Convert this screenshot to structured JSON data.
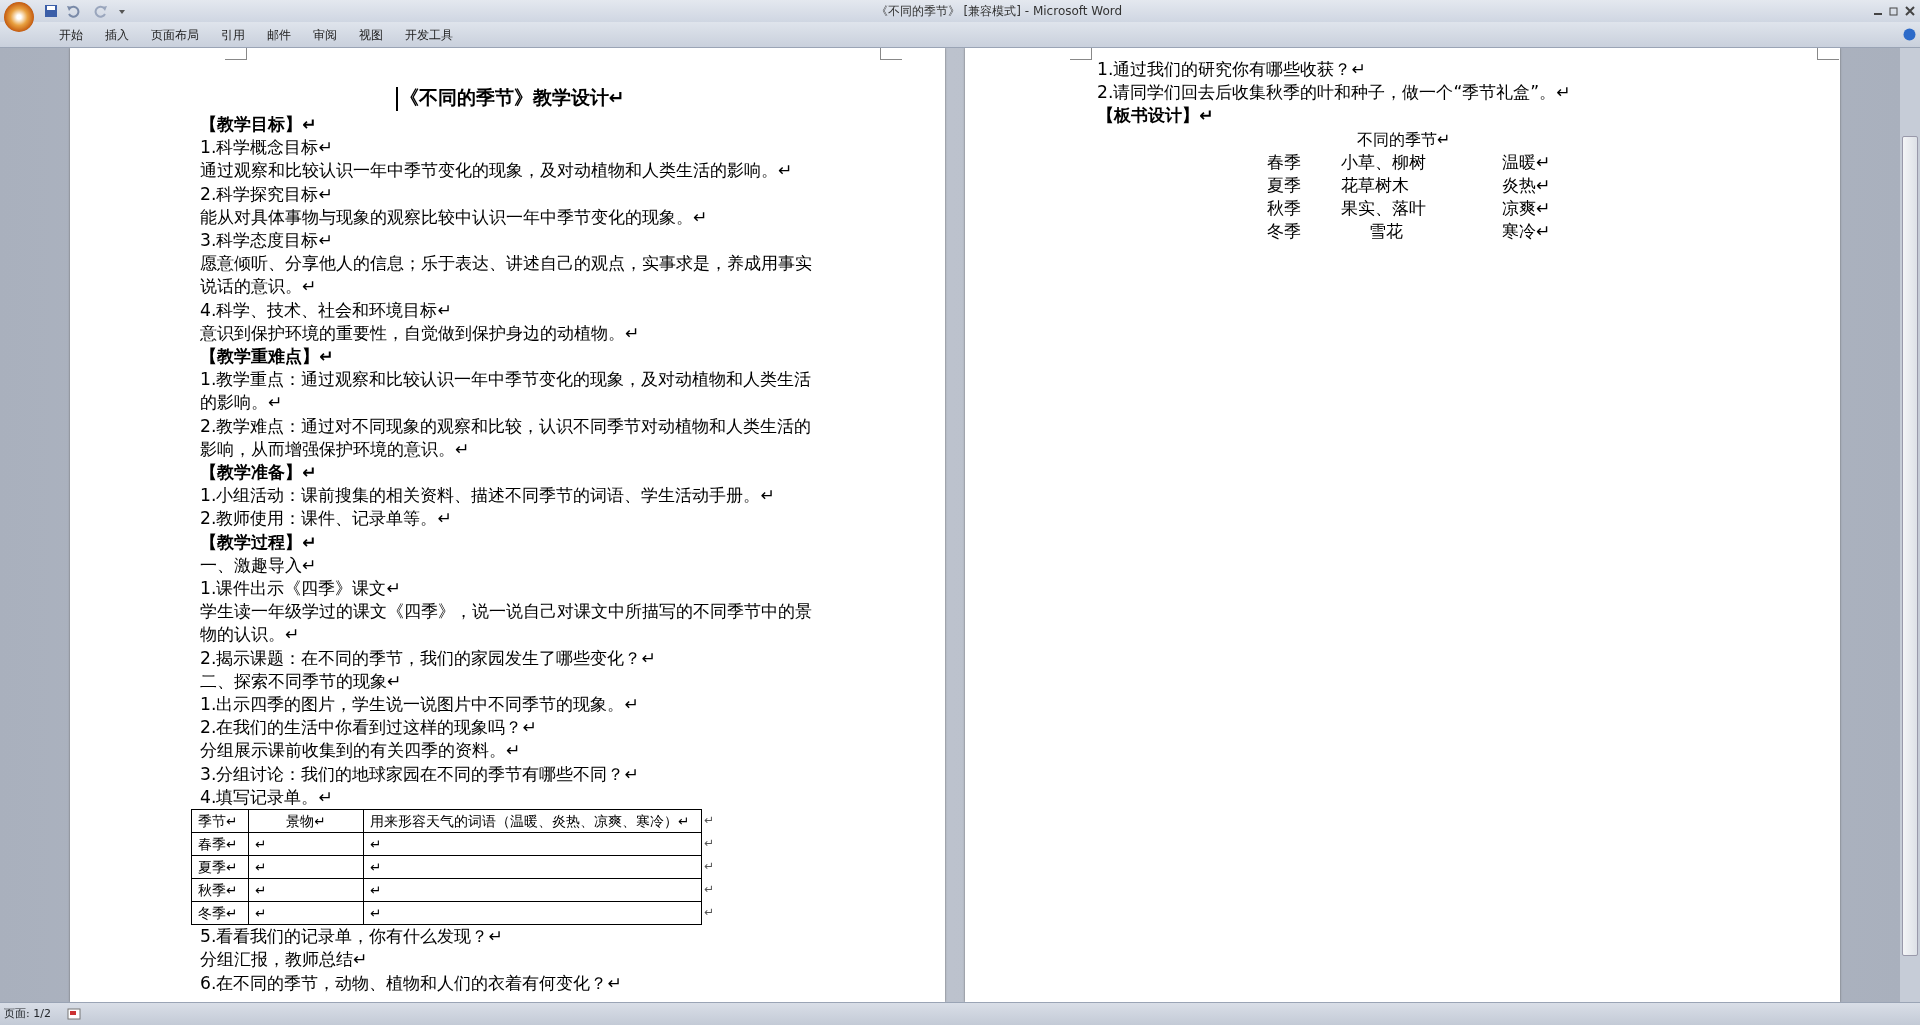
{
  "window": {
    "title": "《不同的季节》 [兼容模式] - Microsoft Word"
  },
  "ribbon_tabs": [
    {
      "label": "开始"
    },
    {
      "label": "插入"
    },
    {
      "label": "页面布局"
    },
    {
      "label": "引用"
    },
    {
      "label": "邮件"
    },
    {
      "label": "审阅"
    },
    {
      "label": "视图"
    },
    {
      "label": "开发工具"
    }
  ],
  "left_page": {
    "title": "《不同的季节》教学设计↵",
    "blocks": [
      {
        "kind": "heading",
        "text": "【教学目标】↵"
      },
      {
        "kind": "text",
        "text": "1.科学概念目标↵"
      },
      {
        "kind": "text",
        "text": "通过观察和比较认识一年中季节变化的现象，及对动植物和人类生活的影响。↵"
      },
      {
        "kind": "text",
        "text": "2.科学探究目标↵"
      },
      {
        "kind": "text",
        "text": "能从对具体事物与现象的观察比较中认识一年中季节变化的现象。↵"
      },
      {
        "kind": "text",
        "text": "3.科学态度目标↵"
      },
      {
        "kind": "text",
        "text": "愿意倾听、分享他人的信息；乐于表达、讲述自己的观点，实事求是，养成用事实说话的意识。↵"
      },
      {
        "kind": "text",
        "text": "4.科学、技术、社会和环境目标↵"
      },
      {
        "kind": "text",
        "text": "意识到保护环境的重要性，自觉做到保护身边的动植物。↵"
      },
      {
        "kind": "heading",
        "text": "【教学重难点】↵"
      },
      {
        "kind": "text",
        "text": "1.教学重点：通过观察和比较认识一年中季节变化的现象，及对动植物和人类生活的影响。↵"
      },
      {
        "kind": "text",
        "text": "2.教学难点：通过对不同现象的观察和比较，认识不同季节对动植物和人类生活的影响，从而增强保护环境的意识。↵"
      },
      {
        "kind": "heading",
        "text": "【教学准备】↵"
      },
      {
        "kind": "text",
        "text": "1.小组活动：课前搜集的相关资料、描述不同季节的词语、学生活动手册。↵"
      },
      {
        "kind": "text",
        "text": "2.教师使用：课件、记录单等。↵"
      },
      {
        "kind": "heading",
        "text": "【教学过程】↵"
      },
      {
        "kind": "text",
        "text": "一、激趣导入↵"
      },
      {
        "kind": "text",
        "text": "1.课件出示《四季》课文↵"
      },
      {
        "kind": "text",
        "text": "学生读一年级学过的课文《四季》，说一说自己对课文中所描写的不同季节中的景物的认识。↵"
      },
      {
        "kind": "text",
        "text": "2.揭示课题：在不同的季节，我们的家园发生了哪些变化？↵"
      },
      {
        "kind": "text",
        "text": "二、探索不同季节的现象↵"
      },
      {
        "kind": "text",
        "text": "1.出示四季的图片，学生说一说图片中不同季节的现象。↵"
      },
      {
        "kind": "text",
        "text": "2.在我们的生活中你看到过这样的现象吗？↵"
      },
      {
        "kind": "text",
        "text": "分组展示课前收集到的有关四季的资料。↵"
      },
      {
        "kind": "text",
        "text": "3.分组讨论：我们的地球家园在不同的季节有哪些不同？↵"
      },
      {
        "kind": "text",
        "text": "4.填写记录单。↵"
      },
      {
        "kind": "table",
        "columns": [
          "季节↵",
          "景物↵",
          "用来形容天气的词语（温暖、炎热、凉爽、寒冷）↵"
        ],
        "rows": [
          [
            "春季↵",
            "↵",
            "↵"
          ],
          [
            "夏季↵",
            "↵",
            "↵"
          ],
          [
            "秋季↵",
            "↵",
            "↵"
          ],
          [
            "冬季↵",
            "↵",
            "↵"
          ]
        ],
        "row_end": "↵"
      },
      {
        "kind": "text",
        "text": "5.看看我们的记录单，你有什么发现？↵"
      },
      {
        "kind": "text",
        "text": "分组汇报，教师总结↵"
      },
      {
        "kind": "text",
        "text": "6.在不同的季节，动物、植物和人们的衣着有何变化？↵"
      }
    ]
  },
  "right_page": {
    "blocks": [
      {
        "kind": "text",
        "text": "1.通过我们的研究你有哪些收获？↵"
      },
      {
        "kind": "text",
        "text": "2.请同学们回去后收集秋季的叶和种子，做一个“季节礼盒”。↵"
      },
      {
        "kind": "heading",
        "text": "【板书设计】↵"
      }
    ],
    "board": {
      "title": "不同的季节↵",
      "rows": [
        [
          "春季",
          "小草、柳树",
          "温暖↵"
        ],
        [
          "夏季",
          "花草树木",
          "炎热↵"
        ],
        [
          "秋季",
          "果实、落叶",
          "凉爽↵"
        ],
        [
          "冬季",
          "雪花",
          "寒冷↵"
        ]
      ]
    }
  },
  "status_bar": {
    "page": "页面: 1/2"
  }
}
